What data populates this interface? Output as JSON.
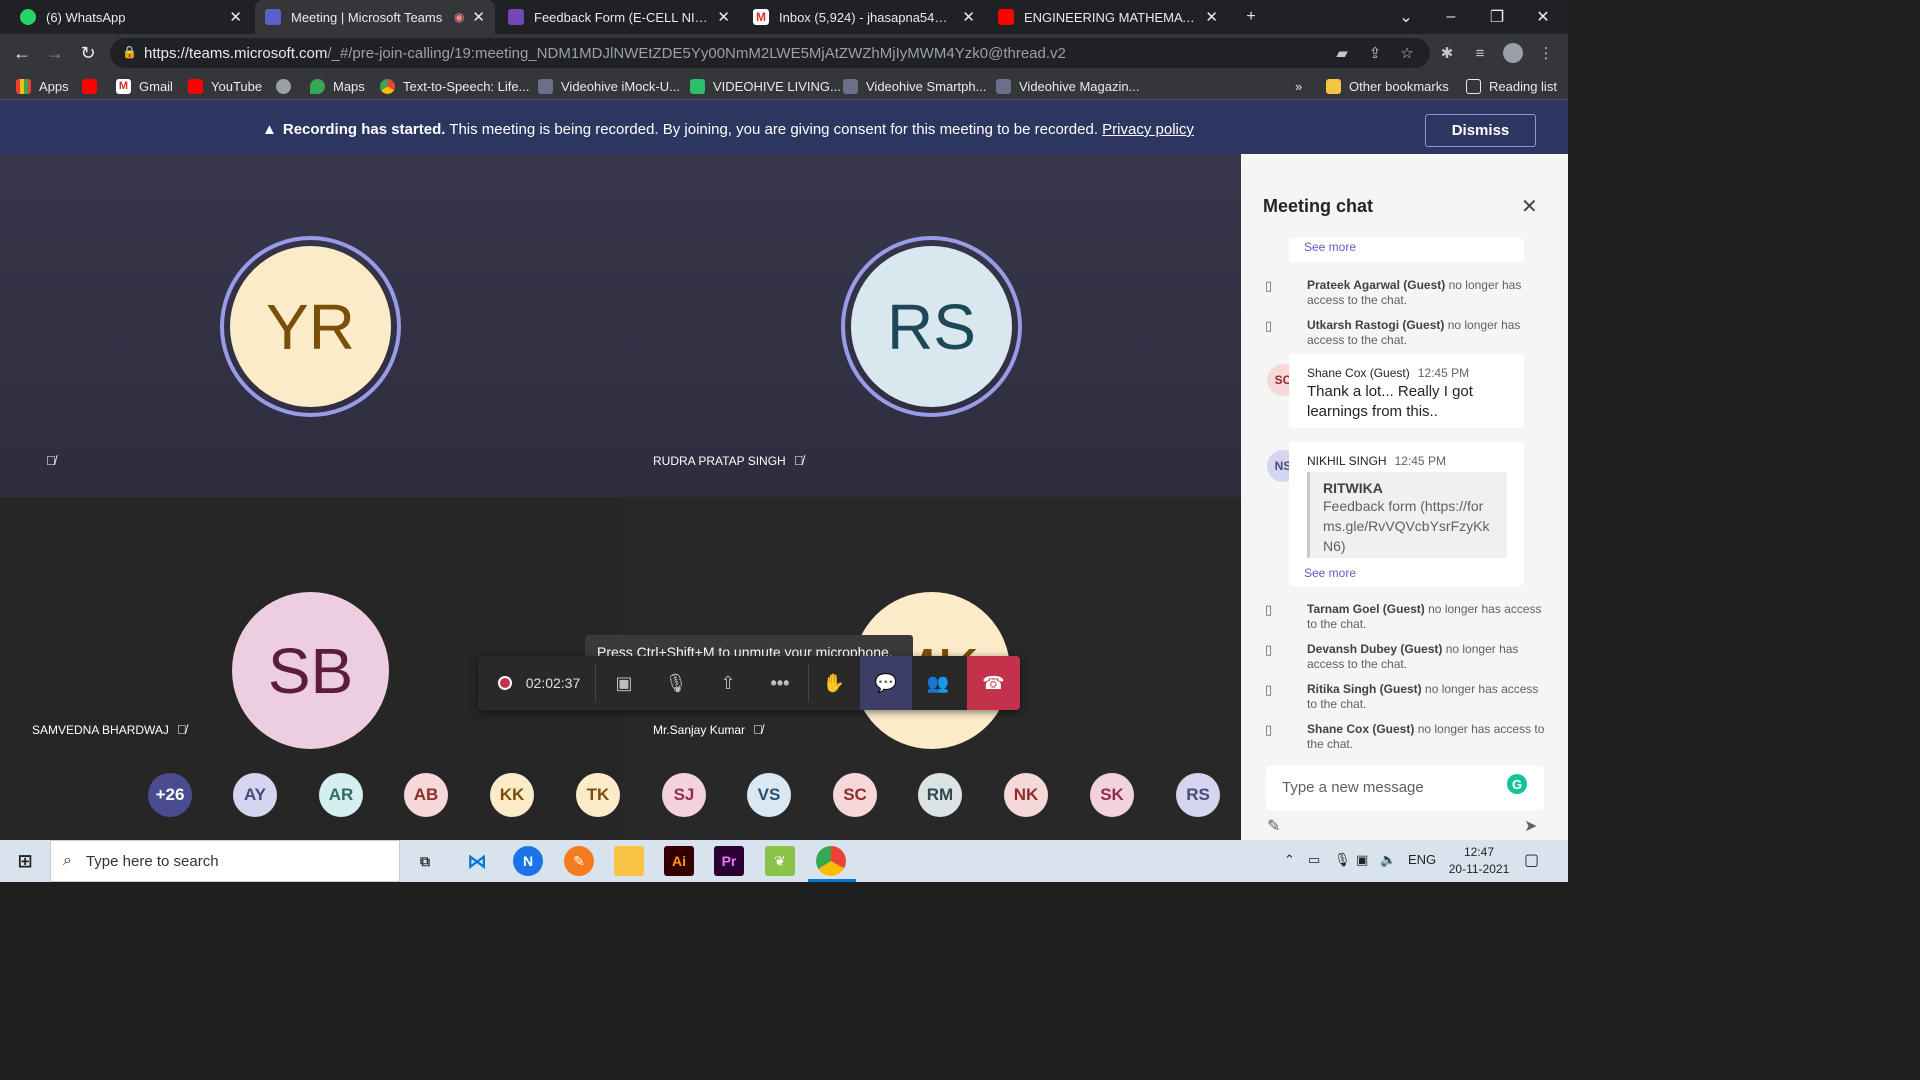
{
  "browser": {
    "tabs": [
      {
        "label": "(6) WhatsApp",
        "active": false
      },
      {
        "label": "Meeting | Microsoft Teams",
        "active": true
      },
      {
        "label": "Feedback Form (E-CELL NIET)",
        "active": false
      },
      {
        "label": "Inbox (5,924) - jhasapna544@gm",
        "active": false
      },
      {
        "label": "ENGINEERING MATHEMATICS-II",
        "active": false
      }
    ],
    "new_tab": "+",
    "url_host": "https://teams.microsoft.com",
    "url_path": "/_#/pre-join-calling/19:meeting_NDM1MDJlNWEtZDE5Yy00NmM2LWE5MjAtZWZhMjIyMWM4Yzk0@thread.v2",
    "bookmarks": [
      {
        "label": "Apps"
      },
      {
        "label": ""
      },
      {
        "label": "Gmail"
      },
      {
        "label": "YouTube"
      },
      {
        "label": ""
      },
      {
        "label": "Maps"
      },
      {
        "label": "Text-to-Speech: Life..."
      },
      {
        "label": "Videohive iMock-U..."
      },
      {
        "label": "VIDEOHIVE LIVING..."
      },
      {
        "label": "Videohive Smartph..."
      },
      {
        "label": "Videohive Magazin..."
      }
    ],
    "overflow": "»",
    "other_bookmarks": "Other bookmarks",
    "reading_list": "Reading list"
  },
  "banner": {
    "bold": "Recording has started.",
    "text": " This meeting is being recorded. By joining, you are giving consent for this meeting to be recorded. ",
    "link": "Privacy policy",
    "dismiss": "Dismiss"
  },
  "participants": {
    "tiles": [
      {
        "initials": "YR",
        "name": ""
      },
      {
        "initials": "RS",
        "name": "RUDRA PRATAP SINGH"
      },
      {
        "initials": "SB",
        "name": "SAMVEDNA BHARDWAJ"
      },
      {
        "initials": "MK",
        "name": "Mr.Sanjay Kumar"
      }
    ],
    "more_count": "+26",
    "gallery": [
      "AY",
      "AR",
      "AB",
      "KK",
      "TK",
      "SJ",
      "VS",
      "SC",
      "RM",
      "NK",
      "SK",
      "RS"
    ]
  },
  "controls": {
    "timer": "02:02:37",
    "tooltip": "Press Ctrl+Shift+M to unmute your microphone."
  },
  "chat": {
    "title": "Meeting chat",
    "see_more": "See more",
    "system_1": [
      {
        "who": "Prateek Agarwal (Guest)",
        "what": " no longer has access to the chat."
      },
      {
        "who": "Utkarsh Rastogi (Guest)",
        "what": " no longer has access to the chat."
      }
    ],
    "msg1": {
      "initials": "SC",
      "name": "Shane Cox (Guest)",
      "time": "12:45 PM",
      "text": "Thank a lot... Really I got learnings from this.."
    },
    "msg2": {
      "initials": "NS",
      "name": "NIKHIL SINGH",
      "time": "12:45 PM",
      "quote_title": "RITWIKA",
      "quote_text": "Feedback form (https://forms.gle/RvVQVcbYsrFzyKkN6)",
      "see_more": "See more"
    },
    "system_2": [
      {
        "who": "Tarnam Goel (Guest)",
        "what": " no longer has access to the chat."
      },
      {
        "who": "Devansh Dubey (Guest)",
        "what": " no longer has access to the chat."
      },
      {
        "who": "Ritika Singh (Guest)",
        "what": " no longer has access to the chat."
      },
      {
        "who": "Shane Cox (Guest)",
        "what": " no longer has access to the chat."
      }
    ],
    "compose_placeholder": "Type a new message"
  },
  "taskbar": {
    "search_placeholder": "Type here to search",
    "lang": "ENG",
    "time": "12:47",
    "date": "20-11-2021"
  },
  "colors": {
    "banner": "#2c3660",
    "accent": "#5b5fc7",
    "hangup": "#c4314b"
  }
}
